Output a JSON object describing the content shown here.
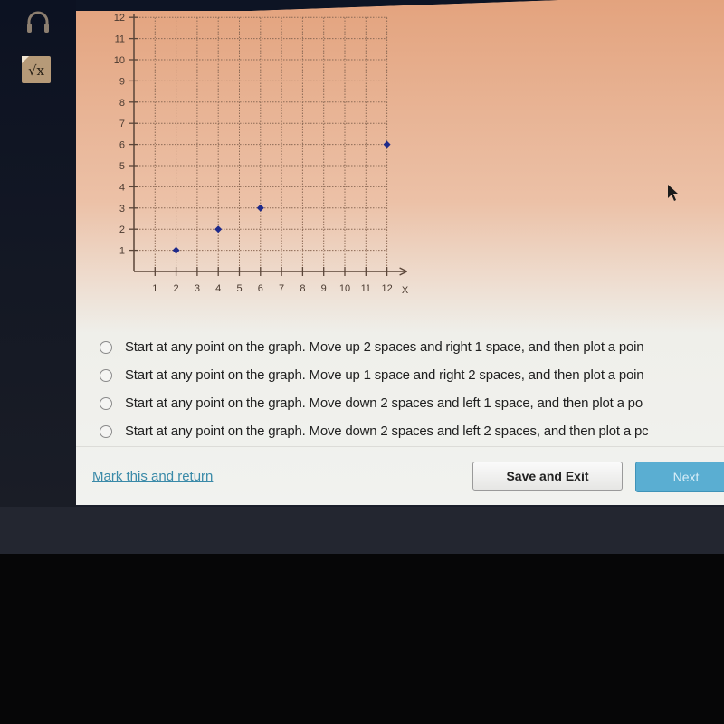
{
  "sidebar": {
    "icons": [
      {
        "name": "headphones-icon",
        "label": ""
      },
      {
        "name": "calculator-icon",
        "label": "√x"
      }
    ]
  },
  "chart_data": {
    "type": "scatter",
    "title": "",
    "xlabel": "X",
    "ylabel": "",
    "xlim": [
      0,
      12
    ],
    "ylim": [
      0,
      12
    ],
    "grid": true,
    "x_ticks": [
      "1",
      "2",
      "3",
      "4",
      "5",
      "6",
      "7",
      "8",
      "9",
      "10",
      "11",
      "12"
    ],
    "y_ticks": [
      "1",
      "2",
      "3",
      "4",
      "5",
      "6",
      "7",
      "8",
      "9",
      "10",
      "11",
      "12"
    ],
    "points": [
      {
        "x": 2,
        "y": 1
      },
      {
        "x": 4,
        "y": 2
      },
      {
        "x": 6,
        "y": 3
      },
      {
        "x": 12,
        "y": 6
      }
    ],
    "point_color": "#1f2a8a"
  },
  "question": {
    "options": [
      {
        "label": "Start at any point on the graph. Move up 2 spaces and right 1 space, and then plot a poin"
      },
      {
        "label": "Start at any point on the graph. Move up 1 space and right 2 spaces, and then plot a poin"
      },
      {
        "label": "Start at any point on the graph. Move down 2 spaces and left 1 space, and then plot a po"
      },
      {
        "label": "Start at any point on the graph. Move down 2 spaces and left 2 spaces, and then plot a pc"
      }
    ]
  },
  "footer": {
    "mark_link": "Mark this and return",
    "save_label": "Save and Exit",
    "next_label": "Next"
  },
  "colors": {
    "link": "#3a8aa8",
    "next_button": "#5aaed2",
    "point": "#1f2a8a"
  }
}
